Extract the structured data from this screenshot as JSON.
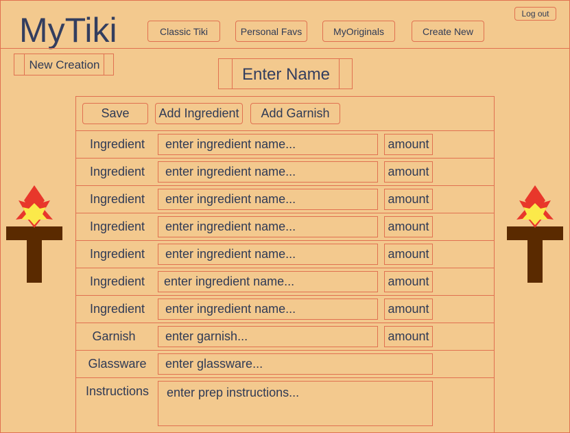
{
  "app": {
    "logo": "MyTiki"
  },
  "nav": {
    "items": [
      "Classic Tiki",
      "Personal Favs",
      "MyOriginals",
      "Create New"
    ],
    "logout_label": "Log out"
  },
  "page": {
    "section_label": "New Creation",
    "name_placeholder": "Enter Name"
  },
  "toolbar": {
    "save_label": "Save",
    "add_ingredient_label": "Add Ingredient",
    "add_garnish_label": "Add Garnish"
  },
  "form": {
    "ingredients": [
      {
        "label": "Ingredient",
        "placeholder": "enter ingredient name...",
        "amount_placeholder": "amount"
      },
      {
        "label": "Ingredient",
        "placeholder": "enter ingredient name...",
        "amount_placeholder": "amount"
      },
      {
        "label": "Ingredient",
        "placeholder": "enter ingredient name...",
        "amount_placeholder": "amount"
      },
      {
        "label": "Ingredient",
        "placeholder": "enter ingredient name...",
        "amount_placeholder": "amount"
      },
      {
        "label": "Ingredient",
        "placeholder": "enter ingredient name...",
        "amount_placeholder": "amount"
      },
      {
        "label": "Ingredient",
        "placeholder": "enter ingredient name...",
        "amount_placeholder": "amount"
      },
      {
        "label": "Ingredient",
        "placeholder": "enter ingredient name...",
        "amount_placeholder": "amount"
      }
    ],
    "garnish": {
      "label": "Garnish",
      "placeholder": "enter garnish...",
      "amount_placeholder": "amount"
    },
    "glassware": {
      "label": "Glassware",
      "placeholder": "enter glassware..."
    },
    "instructions": {
      "label": "Instructions",
      "placeholder": "enter prep instructions..."
    }
  },
  "decor": {
    "left_icon": "tiki-torch-icon",
    "right_icon": "tiki-torch-icon"
  },
  "colors": {
    "background": "#f3c98e",
    "border": "#e07050",
    "text": "#2f3a55",
    "torch_wood": "#5a2a00",
    "flame_red": "#e8372b",
    "flame_yellow": "#fbe94a"
  }
}
